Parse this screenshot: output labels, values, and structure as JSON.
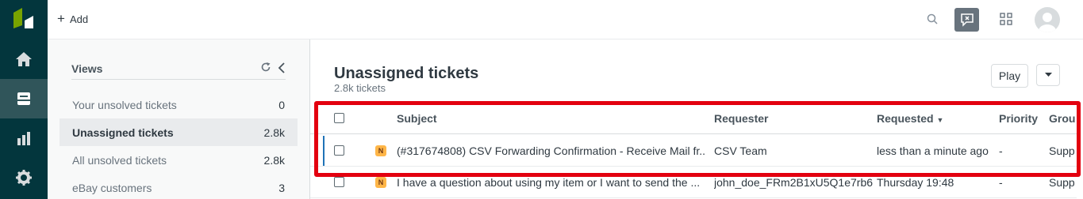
{
  "topbar": {
    "add_label": "Add"
  },
  "views": {
    "title": "Views",
    "items": [
      {
        "label": "Your unsolved tickets",
        "count": "0"
      },
      {
        "label": "Unassigned tickets",
        "count": "2.8k"
      },
      {
        "label": "All unsolved tickets",
        "count": "2.8k"
      },
      {
        "label": "eBay customers",
        "count": "3"
      }
    ]
  },
  "main": {
    "title": "Unassigned tickets",
    "subtitle": "2.8k tickets",
    "play_label": "Play",
    "columns": [
      "Subject",
      "Requester",
      "Requested",
      "Priority",
      "Grou"
    ],
    "sort_indicator": "▼",
    "rows": [
      {
        "badge": "N",
        "subject": "(#317674808) CSV Forwarding Confirmation - Receive Mail fr...",
        "requester": "CSV Team",
        "requested": "less than a minute ago",
        "priority": "-",
        "group": "Supp"
      },
      {
        "badge": "N",
        "subject": "I have a question about using my item or I want to send the ...",
        "requester": "john_doe_FRm2B1xU5Q1e7rb6",
        "requested": "Thursday 19:48",
        "priority": "-",
        "group": "Supp"
      }
    ]
  },
  "colors": {
    "rail": "#03363d",
    "rail_active": "#30555a",
    "highlight": "#e3000f",
    "badge": "#ffb648",
    "row_marker": "#1f73b7"
  }
}
